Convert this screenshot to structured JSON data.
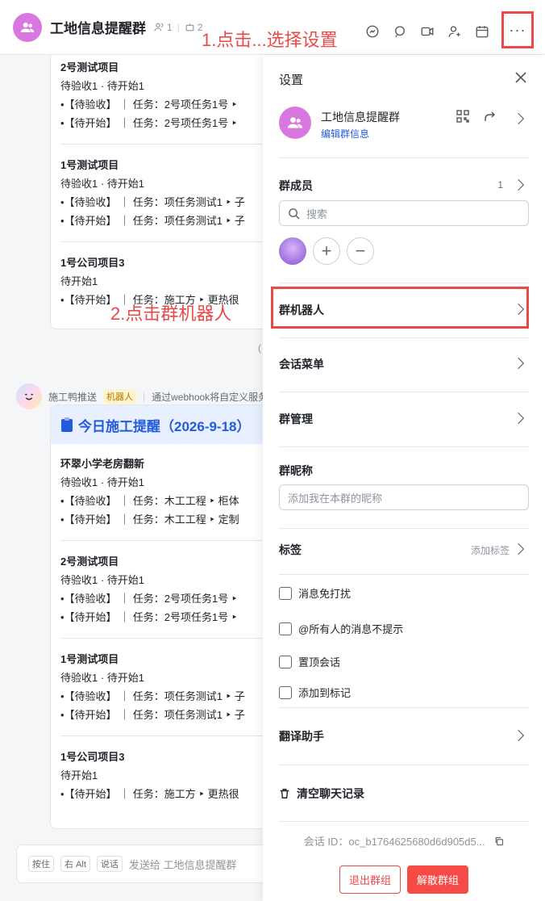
{
  "header": {
    "title": "工地信息提醒群",
    "members": "1",
    "bots": "2"
  },
  "annotations": {
    "step1": "1.点击...选择设置",
    "step2": "2.点击群机器人"
  },
  "chat": {
    "top_card_projects": [
      {
        "name": "2号测试项目",
        "status": "待验收1 · 待开始1",
        "lines": [
          "•【待验收】 ｜ 任务：2号项任务1号 ‣",
          "•【待开始】 ｜ 任务：2号项任务1号 ‣"
        ]
      },
      {
        "name": "1号测试项目",
        "status": "待验收1 · 待开始1",
        "lines": [
          "•【待验收】 ｜ 任务：项任务测试1 ‣ 子",
          "•【待开始】 ｜ 任务：项任务测试1 ‣ 子"
        ]
      },
      {
        "name": "1号公司项目3",
        "status": "待开始1",
        "lines": [
          "•【待开始】 ｜ 任务：施工方 ‣ 更热很"
        ]
      }
    ],
    "bot": {
      "name": "施工鸭推送",
      "tag": "机器人",
      "desc": "通过webhook将自定义服务的"
    },
    "card_title": "今日施工提醒（2026-9-18）",
    "card_projects": [
      {
        "name": "环翠小学老房翻新",
        "status": "待验收1 · 待开始1",
        "lines": [
          "•【待验收】 ｜ 任务：木工工程 ‣ 柜体",
          "•【待开始】 ｜ 任务：木工工程 ‣ 定制"
        ]
      },
      {
        "name": "2号测试项目",
        "status": "待验收1 · 待开始1",
        "lines": [
          "•【待验收】 ｜ 任务：2号项任务1号 ‣",
          "•【待开始】 ｜ 任务：2号项任务1号 ‣"
        ]
      },
      {
        "name": "1号测试项目",
        "status": "待验收1 · 待开始1",
        "lines": [
          "•【待验收】 ｜ 任务：项任务测试1 ‣ 子",
          "•【待开始】 ｜ 任务：项任务测试1 ‣ 子"
        ]
      },
      {
        "name": "1号公司项目3",
        "status": "待开始1",
        "lines": [
          "•【待开始】 ｜ 任务：施工方 ‣ 更热很"
        ]
      }
    ],
    "composer": {
      "hint_key1": "按住",
      "hint_key2": "右 Alt",
      "hint_key3": "说话",
      "placeholder": "发送给 工地信息提醒群"
    }
  },
  "settings": {
    "title": "设置",
    "group_name": "工地信息提醒群",
    "edit_info": "编辑群信息",
    "members_label": "群成员",
    "members_count": "1",
    "search_placeholder": "搜索",
    "robot_label": "群机器人",
    "menu_label": "会话菜单",
    "manage_label": "群管理",
    "nickname_label": "群昵称",
    "nickname_placeholder": "添加我在本群的昵称",
    "tags_label": "标签",
    "add_tag": "添加标签",
    "options": [
      "消息免打扰",
      "@所有人的消息不提示",
      "置顶会话",
      "添加到标记"
    ],
    "translate_label": "翻译助手",
    "clear_label": "清空聊天记录",
    "session_id": "会话 ID：oc_b1764625680d6d905d5...",
    "exit_button": "退出群组",
    "dissolve_button": "解散群组"
  },
  "colors": {
    "accent_red": "#e84a4a",
    "link_blue": "#245bdb",
    "group_purple": "#d977e0"
  }
}
